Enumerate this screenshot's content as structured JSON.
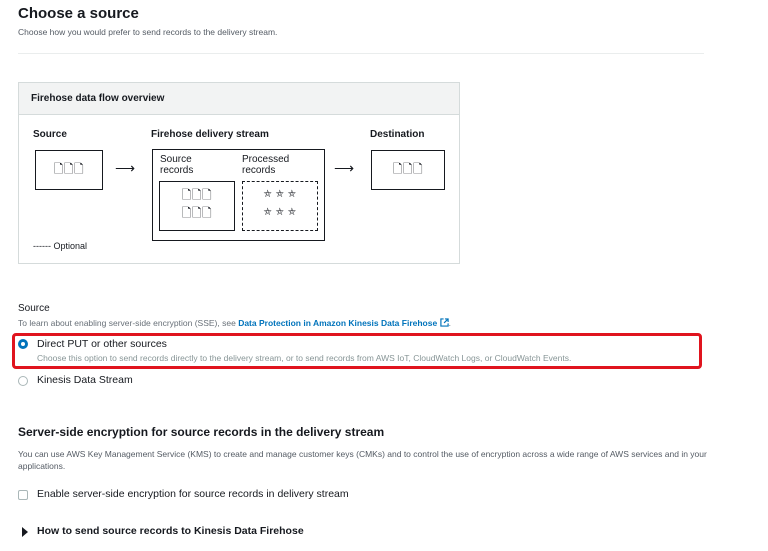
{
  "header": {
    "title": "Choose a source",
    "subtitle": "Choose how you would prefer to send records to the delivery stream."
  },
  "diagram": {
    "title": "Firehose data flow overview",
    "source_label": "Source",
    "stream_label": "Firehose delivery stream",
    "destination_label": "Destination",
    "source_records_line1": "Source",
    "source_records_line2": "records",
    "processed_records_line1": "Processed",
    "processed_records_line2": "records",
    "optional_legend": "------ Optional"
  },
  "source": {
    "label": "Source",
    "description_prefix": "To learn about enabling server-side encryption (SSE), see ",
    "description_link": "Data Protection in Amazon Kinesis Data Firehose",
    "description_suffix": ".",
    "options": [
      {
        "label": "Direct PUT or other sources",
        "description": "Choose this option to send records directly to the delivery stream, or to send records from AWS IoT, CloudWatch Logs, or CloudWatch Events.",
        "selected": true
      },
      {
        "label": "Kinesis Data Stream",
        "selected": false
      }
    ]
  },
  "encryption": {
    "title": "Server-side encryption for source records in the delivery stream",
    "description": "You can use AWS Key Management Service (KMS) to create and manage customer keys (CMKs) and to control the use of encryption across a wide range of AWS services and in your applications.",
    "checkbox_label": "Enable server-side encryption for source records in delivery stream",
    "checked": false
  },
  "expander": {
    "label": "How to send source records to Kinesis Data Firehose"
  },
  "colors": {
    "accent": "#0073bb",
    "highlight": "#e0141e"
  }
}
